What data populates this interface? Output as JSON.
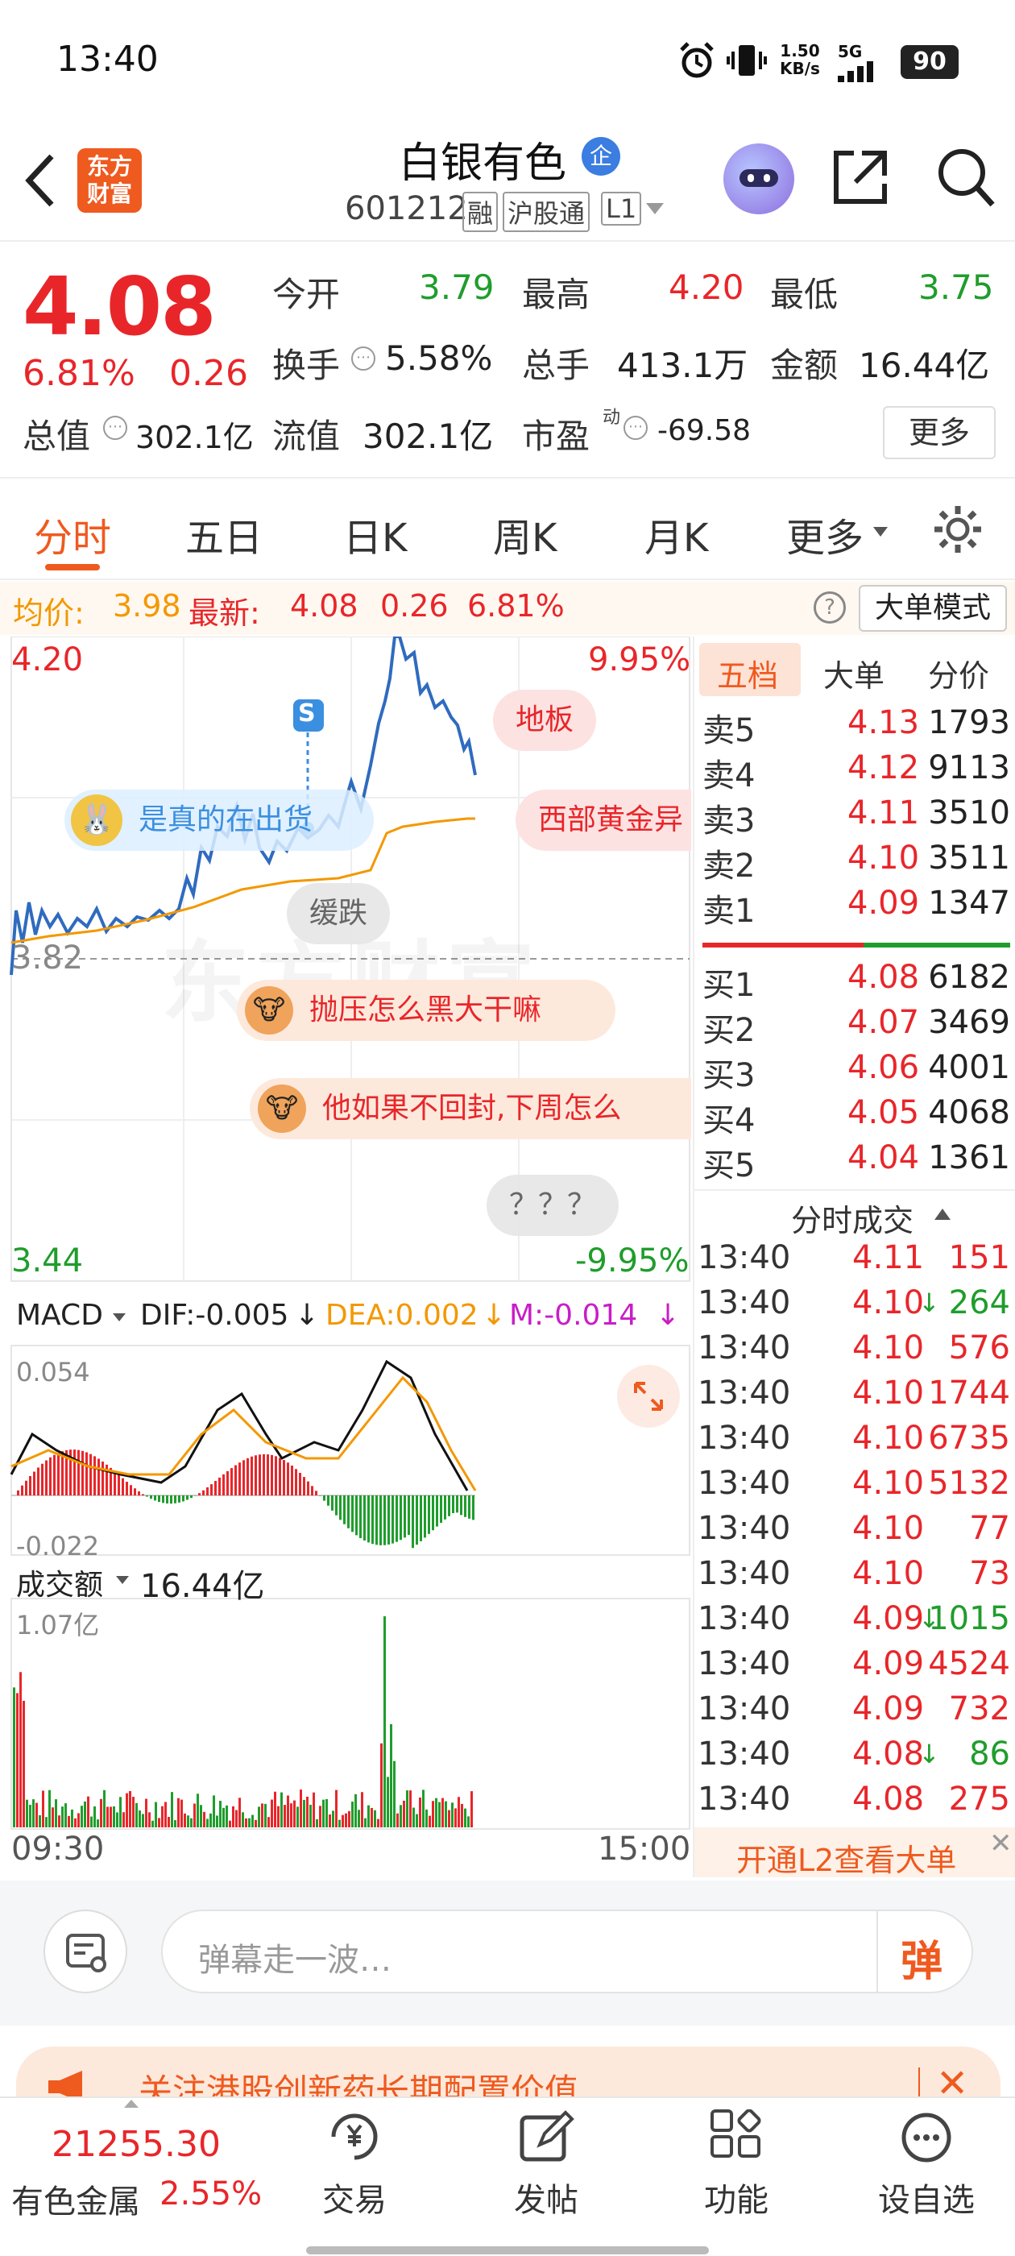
{
  "status_bar": {
    "time": "13:40",
    "net_speed_top": "1.50",
    "net_speed_unit": "KB/s",
    "signal": "5G",
    "battery": "90"
  },
  "header": {
    "logo_top": "东方",
    "logo_bottom": "财富",
    "stock_name": "白银有色",
    "stock_code": "601212",
    "tags": [
      "融",
      "沪股通",
      "L1"
    ]
  },
  "quote": {
    "price": "4.08",
    "change_pct": "6.81%",
    "change_amt": "0.26",
    "open_label": "今开",
    "open": "3.79",
    "high_label": "最高",
    "high": "4.20",
    "low_label": "最低",
    "low": "3.75",
    "turnover_label": "换手",
    "turnover": "5.58%",
    "volume_label": "总手",
    "volume": "413.1万",
    "amount_label": "金额",
    "amount": "16.44亿",
    "mktcap_label": "总值",
    "mktcap": "302.1亿",
    "float_label": "流值",
    "float": "302.1亿",
    "pe_label": "市盈",
    "pe_sup": "动",
    "pe": "-69.58",
    "more": "更多"
  },
  "tabs": [
    "分时",
    "五日",
    "日K",
    "周K",
    "月K",
    "更多"
  ],
  "info_bar": {
    "avg_label": "均价:",
    "avg": "3.98",
    "latest_label": "最新:",
    "latest": "4.08",
    "chg": "0.26",
    "pct": "6.81%",
    "mode_button": "大单模式"
  },
  "chart": {
    "y_top": "4.20",
    "y_mid": "3.82",
    "y_bottom": "3.44",
    "pct_top": "9.95%",
    "pct_bottom": "-9.95%",
    "time_start": "09:30",
    "time_end": "15:00",
    "s_marker": "S",
    "watermark": "东方财富"
  },
  "danmaku": [
    {
      "text": "地板"
    },
    {
      "text": "是真的在出货"
    },
    {
      "text": "西部黄金异"
    },
    {
      "text": "缓跌"
    },
    {
      "text": "抛压怎么黑大干嘛"
    },
    {
      "text": "他如果不回封,下周怎么"
    },
    {
      "text": "？？？"
    }
  ],
  "macd": {
    "label": "MACD",
    "dif": "DIF:-0.005",
    "dea": "DEA:0.002",
    "m": "M:-0.014",
    "y_max": "0.054",
    "y_min": "-0.022"
  },
  "volume_panel": {
    "label": "成交额",
    "value": "16.44亿",
    "y_max": "1.07亿"
  },
  "order_book": {
    "tabs": [
      "五档",
      "大单",
      "分价"
    ],
    "asks": [
      {
        "label": "卖5",
        "price": "4.13",
        "vol": "1793"
      },
      {
        "label": "卖4",
        "price": "4.12",
        "vol": "9113"
      },
      {
        "label": "卖3",
        "price": "4.11",
        "vol": "3510"
      },
      {
        "label": "卖2",
        "price": "4.10",
        "vol": "3511"
      },
      {
        "label": "卖1",
        "price": "4.09",
        "vol": "1347"
      }
    ],
    "bids": [
      {
        "label": "买1",
        "price": "4.08",
        "vol": "6182"
      },
      {
        "label": "买2",
        "price": "4.07",
        "vol": "3469"
      },
      {
        "label": "买3",
        "price": "4.06",
        "vol": "4001"
      },
      {
        "label": "买4",
        "price": "4.05",
        "vol": "4068"
      },
      {
        "label": "买5",
        "price": "4.04",
        "vol": "1361"
      }
    ],
    "ticks_title": "分时成交",
    "ticks": [
      {
        "time": "13:40",
        "price": "4.11",
        "vol": "151",
        "arrow": ""
      },
      {
        "time": "13:40",
        "price": "4.10",
        "vol": "264",
        "arrow": "↓"
      },
      {
        "time": "13:40",
        "price": "4.10",
        "vol": "576",
        "arrow": ""
      },
      {
        "time": "13:40",
        "price": "4.10",
        "vol": "1744",
        "arrow": ""
      },
      {
        "time": "13:40",
        "price": "4.10",
        "vol": "6735",
        "arrow": ""
      },
      {
        "time": "13:40",
        "price": "4.10",
        "vol": "5132",
        "arrow": ""
      },
      {
        "time": "13:40",
        "price": "4.10",
        "vol": "77",
        "arrow": ""
      },
      {
        "time": "13:40",
        "price": "4.10",
        "vol": "73",
        "arrow": ""
      },
      {
        "time": "13:40",
        "price": "4.09",
        "vol": "1015",
        "arrow": "↓"
      },
      {
        "time": "13:40",
        "price": "4.09",
        "vol": "4524",
        "arrow": ""
      },
      {
        "time": "13:40",
        "price": "4.09",
        "vol": "732",
        "arrow": ""
      },
      {
        "time": "13:40",
        "price": "4.08",
        "vol": "86",
        "arrow": "↓"
      },
      {
        "time": "13:40",
        "price": "4.08",
        "vol": "275",
        "arrow": ""
      }
    ],
    "l2_button": "开通L2查看大单"
  },
  "comment_bar": {
    "placeholder": "弹幕走一波…",
    "send": "弹"
  },
  "banner": {
    "text": "关注港股创新药长期配置价值"
  },
  "bottom_nav": {
    "index_value": "21255.30",
    "index_name": "有色金属",
    "index_pct": "2.55%",
    "items": [
      "交易",
      "发帖",
      "功能",
      "设自选"
    ]
  },
  "colors": {
    "up": "#e8262a",
    "down": "#1f9d2c",
    "avg_line": "#f39800",
    "price_line": "#2f6bbf",
    "accent": "#ef5a1f"
  }
}
